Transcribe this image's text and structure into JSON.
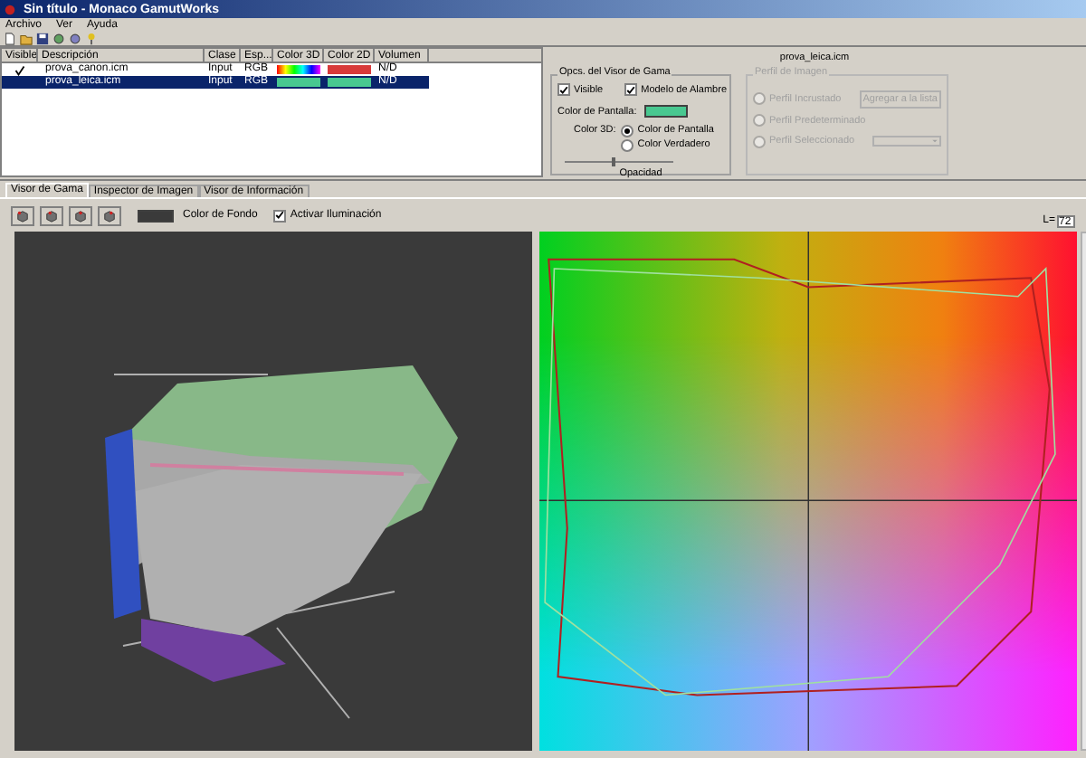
{
  "window": {
    "title": "Sin título - Monaco GamutWorks"
  },
  "menu": [
    "Archivo",
    "Ver",
    "Ayuda"
  ],
  "profiles": {
    "columns": [
      "Visible",
      "Descripción",
      "Clase",
      "Esp...",
      "Color 3D",
      "Color 2D",
      "Volumen"
    ],
    "rows": [
      {
        "visible": true,
        "selected": false,
        "description": "prova_canon.icm",
        "class": "Input",
        "space": "RGB",
        "swatch_3d": {
          "kind": "rainbow"
        },
        "swatch_2d": {
          "kind": "solid",
          "color": "#d83a3a"
        },
        "volume": "N/D"
      },
      {
        "visible": false,
        "selected": true,
        "description": "prova_leica.icm",
        "class": "Input",
        "space": "RGB",
        "swatch_3d": {
          "kind": "solid",
          "color": "#48c890"
        },
        "swatch_2d": {
          "kind": "solid",
          "color": "#48c890"
        },
        "volume": "N/D"
      }
    ]
  },
  "properties": {
    "title": "prova_leica.icm",
    "gamut_options": {
      "title": "Opcs. del Visor de Gama",
      "visible": {
        "label": "Visible",
        "checked": true
      },
      "wireframe": {
        "label": "Modelo de Alambre",
        "checked": true
      },
      "screen_color_label": "Color de Pantalla:",
      "screen_swatch": {
        "color": "#48c890"
      },
      "color_3d_label": "Color 3D:",
      "color_3d_options": [
        {
          "label": "Color de Pantalla",
          "selected": true
        },
        {
          "label": "Color Verdadero",
          "selected": false
        }
      ],
      "opacity": {
        "label": "Opacidad",
        "level": 0.45
      }
    },
    "image_profile": {
      "title": "Perfil de Imagen",
      "disabled": true,
      "options": [
        {
          "label": "Perfil Incrustado",
          "selected": false
        },
        {
          "label": "Perfil Predeterminado",
          "selected": false
        },
        {
          "label": "Perfil Seleccionado",
          "selected": false
        }
      ],
      "add_button": "Agregar a la lista"
    }
  },
  "tabs": [
    {
      "label": "Visor de Gama",
      "selected": true
    },
    {
      "label": "Inspector de Imagen",
      "selected": false
    },
    {
      "label": "Visor de Información",
      "selected": false
    }
  ],
  "view_toolbar": {
    "background_swatch": {
      "color": "#3a3a3a"
    },
    "background_label": "Color de Fondo",
    "lighting": {
      "label": "Activar Iluminación",
      "checked": true
    }
  },
  "plot": {
    "l_label": "L=",
    "l_value": "72"
  }
}
